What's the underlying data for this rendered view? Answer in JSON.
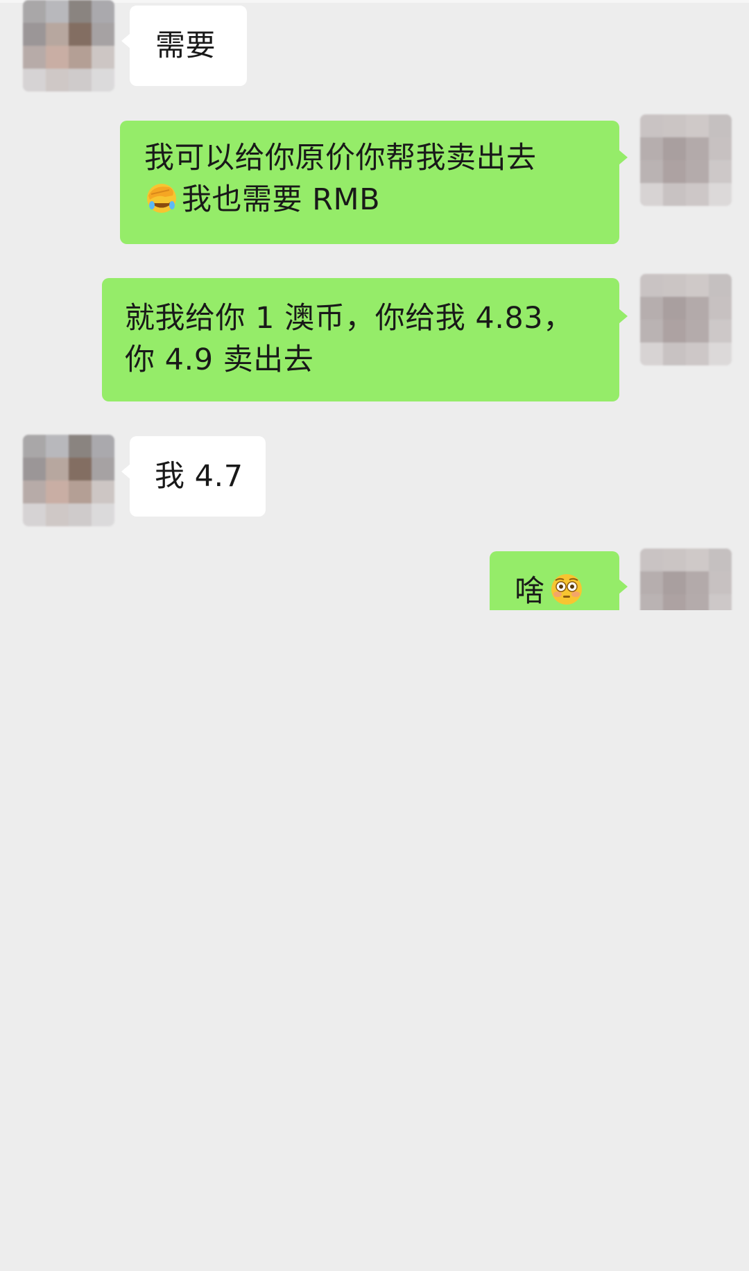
{
  "conversation": {
    "messages": [
      {
        "sender": "contact",
        "text": "需要"
      },
      {
        "sender": "me",
        "lines": [
          {
            "emoji": "",
            "text": "我可以给你原价你帮我卖出去"
          },
          {
            "emoji": "facepalm-emoji",
            "text": "我也需要 RMB"
          }
        ]
      },
      {
        "sender": "me",
        "lines": [
          {
            "text": "就我给你 1 澳币，你给我 4.83，"
          },
          {
            "text": "你 4.9 卖出去"
          }
        ]
      },
      {
        "sender": "contact",
        "text": "我 4.7"
      },
      {
        "sender": "me",
        "text": "啥",
        "emoji": "flushed-face-emoji"
      }
    ]
  },
  "colors": {
    "background": "#ededed",
    "incoming_bubble": "#ffffff",
    "outgoing_bubble": "#95ec69",
    "text": "#191919"
  }
}
